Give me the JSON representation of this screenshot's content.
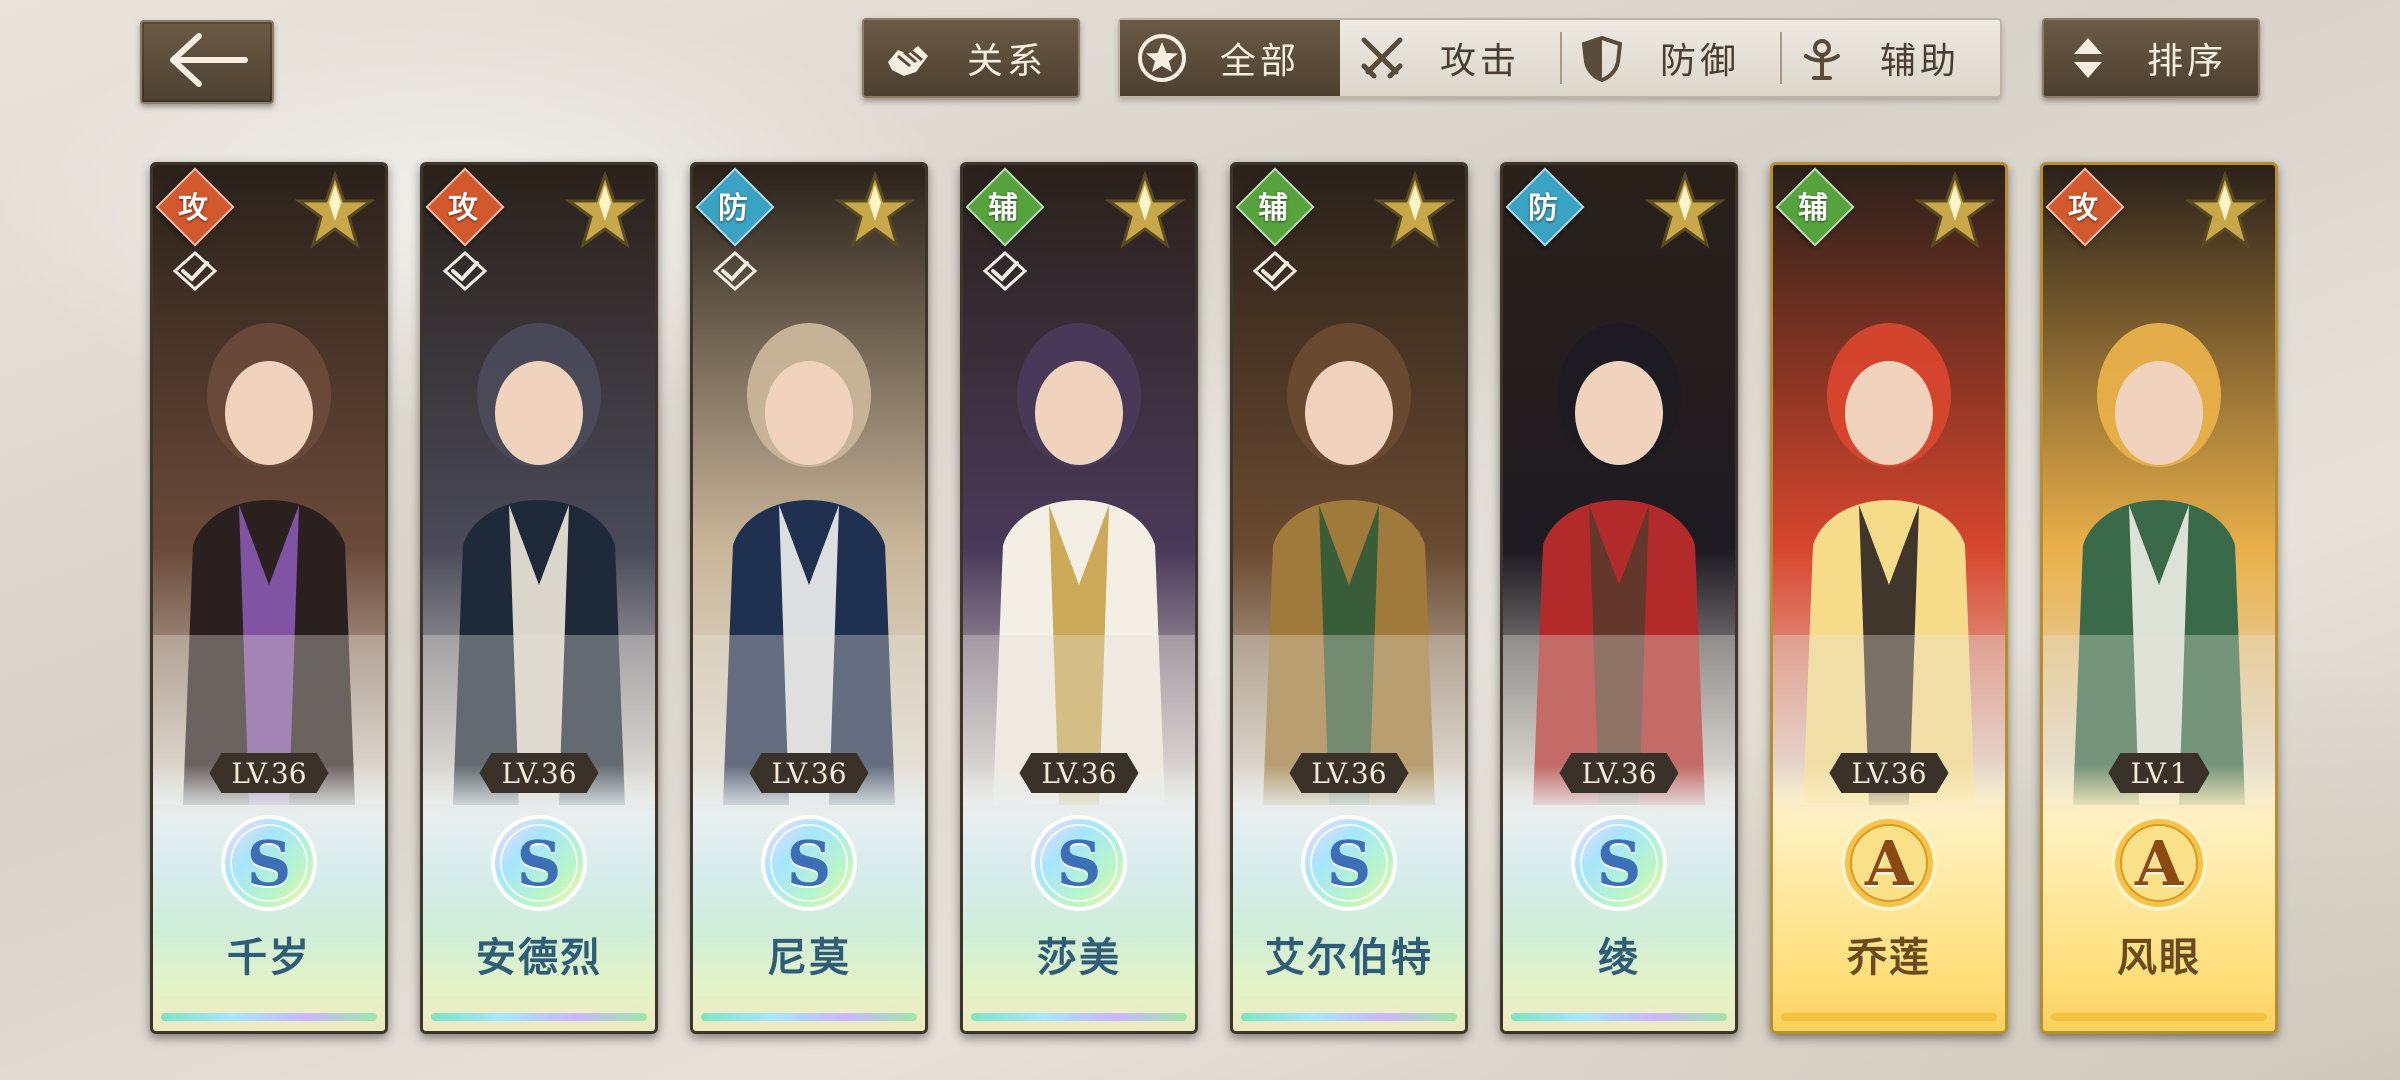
{
  "topbar": {
    "relation_label": "关系",
    "sort_label": "排序",
    "filters": [
      {
        "label": "全部",
        "icon": "star-circle-icon",
        "active": true
      },
      {
        "label": "攻击",
        "icon": "crossed-swords-icon",
        "active": false
      },
      {
        "label": "防御",
        "icon": "shield-icon",
        "active": false
      },
      {
        "label": "辅助",
        "icon": "support-icon",
        "active": false
      }
    ]
  },
  "colors": {
    "button_dark": "#5a4b3a",
    "attack": "#d2582d",
    "defense": "#3aa2c3",
    "support": "#56a33e",
    "rank_a_gold": "#f4c23c"
  },
  "characters": [
    {
      "name": "千岁",
      "role": "攻",
      "role_type": "attack",
      "level": "LV.36",
      "rank": "S",
      "checked": true,
      "palette": [
        "#6b4a3a",
        "#2a2020",
        "#8a5ab0"
      ]
    },
    {
      "name": "安德烈",
      "role": "攻",
      "role_type": "attack",
      "level": "LV.36",
      "rank": "S",
      "checked": true,
      "palette": [
        "#4a4a5a",
        "#1e2a3a",
        "#efe9dc"
      ]
    },
    {
      "name": "尼莫",
      "role": "防",
      "role_type": "defense",
      "level": "LV.36",
      "rank": "S",
      "checked": true,
      "palette": [
        "#c9b69a",
        "#1f3050",
        "#f2f2f2"
      ]
    },
    {
      "name": "莎美",
      "role": "辅",
      "role_type": "support",
      "level": "LV.36",
      "rank": "S",
      "checked": true,
      "palette": [
        "#4a3a5a",
        "#f3efe5",
        "#c9a24a"
      ]
    },
    {
      "name": "艾尔伯特",
      "role": "辅",
      "role_type": "support",
      "level": "LV.36",
      "rank": "S",
      "checked": true,
      "palette": [
        "#6a4a30",
        "#a07a3a",
        "#2f5a3a"
      ]
    },
    {
      "name": "绫",
      "role": "防",
      "role_type": "defense",
      "level": "LV.36",
      "rank": "S",
      "checked": false,
      "palette": [
        "#1e1a22",
        "#b22a2a",
        "#5a3a2a"
      ]
    },
    {
      "name": "乔莲",
      "role": "辅",
      "role_type": "support",
      "level": "LV.36",
      "rank": "A",
      "checked": false,
      "palette": [
        "#d8462e",
        "#f6dc8a",
        "#2e2420"
      ]
    },
    {
      "name": "风眼",
      "role": "攻",
      "role_type": "attack",
      "level": "LV.1",
      "rank": "A",
      "checked": false,
      "palette": [
        "#e9b04a",
        "#3a6a4a",
        "#f0efe6"
      ]
    }
  ]
}
